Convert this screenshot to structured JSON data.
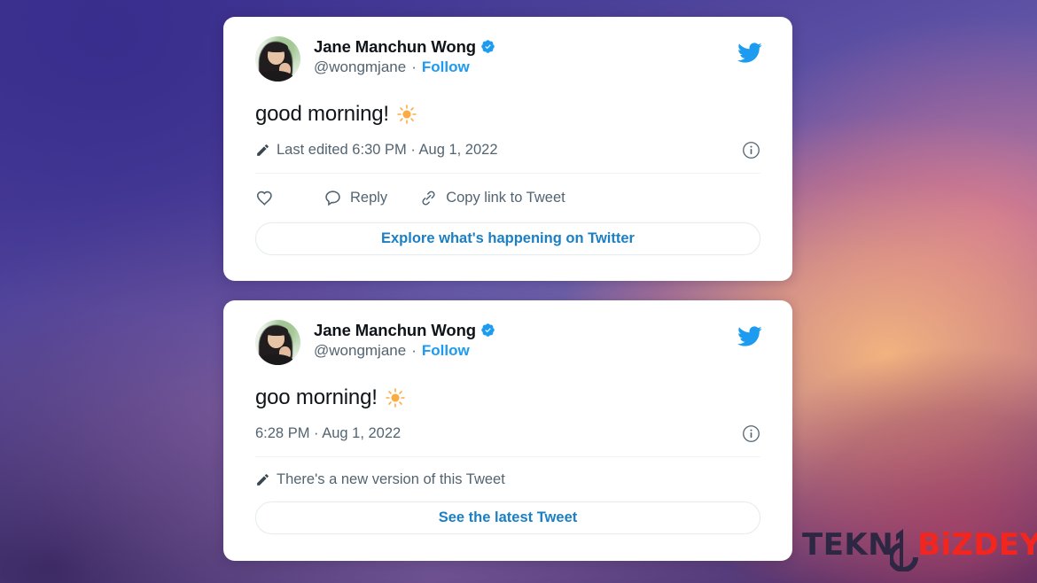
{
  "background": {
    "description": "blurred purple-to-orange gradient wallpaper",
    "colors": {
      "indigo": "#3f3691",
      "violet": "#6257a8",
      "lilac": "#7c6aa9",
      "deep_purple": "#3c2663",
      "orange_glow": "#f7b77e",
      "pink_glow": "#e28096",
      "magenta_glow": "#aa3e60"
    }
  },
  "brand": {
    "twitter_blue": "#1d9bf0",
    "link_blue": "#1b7fc4",
    "text_primary": "#0f1419",
    "text_secondary": "#536471"
  },
  "tweets": [
    {
      "id": "edited-tweet",
      "author": {
        "display_name": "Jane Manchun Wong",
        "handle": "@wongmjane",
        "verified": true,
        "verified_icon": "verified-badge-icon",
        "avatar_icon": "avatar-image"
      },
      "separator": "·",
      "follow_label": "Follow",
      "brand_icon": "twitter-bird-icon",
      "body": "good morning!",
      "body_emoji": "sun-emoji",
      "meta": {
        "edit_icon": "pencil-icon",
        "text": "Last edited 6:30 PM · Aug 1, 2022",
        "info_icon": "info-circle-icon"
      },
      "actions": [
        {
          "icon": "heart-icon",
          "label": ""
        },
        {
          "icon": "speech-bubble-icon",
          "label": "Reply"
        },
        {
          "icon": "link-chain-icon",
          "label": "Copy link to Tweet"
        }
      ],
      "cta_label": "Explore what's happening on Twitter"
    },
    {
      "id": "original-tweet",
      "author": {
        "display_name": "Jane Manchun Wong",
        "handle": "@wongmjane",
        "verified": true,
        "verified_icon": "verified-badge-icon",
        "avatar_icon": "avatar-image"
      },
      "separator": "·",
      "follow_label": "Follow",
      "brand_icon": "twitter-bird-icon",
      "body": "goo morning!",
      "body_emoji": "sun-emoji",
      "meta": {
        "text": "6:28 PM · Aug 1, 2022",
        "info_icon": "info-circle-icon"
      },
      "notice": {
        "edit_icon": "pencil-icon",
        "text": "There's a new version of this Tweet"
      },
      "cta_label": "See the latest Tweet"
    }
  ],
  "watermark": {
    "text_dark": "TEKN",
    "logo_icon": "tekno-b-logo-icon",
    "text_red": "BiZDEYiZ",
    "color_dark": "#2e2744",
    "color_red": "#f2261e"
  }
}
